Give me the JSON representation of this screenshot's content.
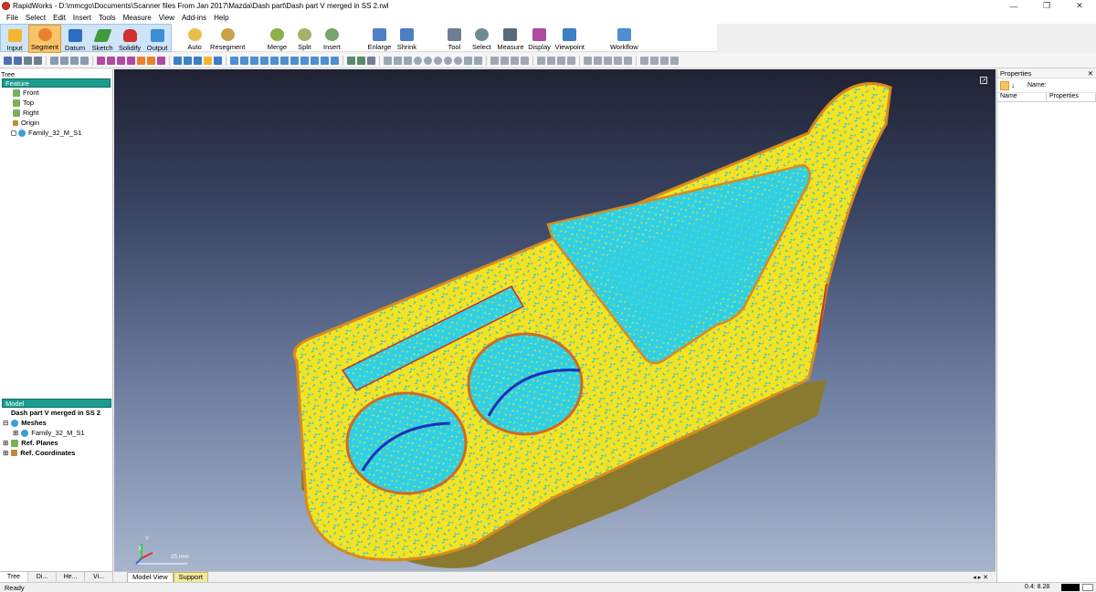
{
  "window": {
    "title": "RapidWorks - D:\\mmcgo\\Documents\\Scanner files From Jan 2017\\Mazda\\Dash part\\Dash part V merged in SS 2.rwl",
    "min": "—",
    "max": "❐",
    "close": "✕"
  },
  "menu": [
    "File",
    "Select",
    "Edit",
    "Insert",
    "Tools",
    "Measure",
    "View",
    "Add-ins",
    "Help"
  ],
  "ribbon": {
    "mode_buttons": [
      {
        "label": "Input",
        "icon": "input-icon",
        "color": "#f2b632"
      },
      {
        "label": "Segment",
        "icon": "segment-icon",
        "color": "#e9822d",
        "active": true
      },
      {
        "label": "Datum",
        "icon": "datum-icon",
        "color": "#2b6cc4"
      },
      {
        "label": "Sketch",
        "icon": "sketch-icon",
        "color": "#3f9a3a"
      },
      {
        "label": "Solidify",
        "icon": "solidify-icon",
        "color": "#d0312d"
      },
      {
        "label": "Output",
        "icon": "output-icon",
        "color": "#3a8fd6"
      }
    ],
    "tool_buttons": [
      {
        "label": "Auto",
        "icon": "auto-icon"
      },
      {
        "label": "Resegment",
        "icon": "resegment-icon"
      },
      {
        "label": "Merge",
        "icon": "merge-icon"
      },
      {
        "label": "Split",
        "icon": "split-icon"
      },
      {
        "label": "Insert",
        "icon": "insert-icon"
      },
      {
        "label": "Enlarge",
        "icon": "enlarge-icon"
      },
      {
        "label": "Shrink",
        "icon": "shrink-icon"
      },
      {
        "label": "Tool",
        "icon": "tool-icon"
      },
      {
        "label": "Select",
        "icon": "select-icon"
      },
      {
        "label": "Measure",
        "icon": "measure-icon"
      },
      {
        "label": "Display",
        "icon": "display-icon"
      },
      {
        "label": "Viewpoint",
        "icon": "viewpoint-icon"
      },
      {
        "label": "Workflow",
        "icon": "workflow-icon"
      }
    ]
  },
  "left_panel": {
    "header": "Tree",
    "feature_section": "Feature",
    "feature_items": [
      "Front",
      "Top",
      "Right",
      "Origin",
      "Family_32_M_S1"
    ],
    "model_section": "Model",
    "model_root": "Dash part V merged in SS 2",
    "model_items": [
      {
        "label": "Meshes",
        "bold": true
      },
      {
        "label": "Family_32_M_S1",
        "bold": false
      },
      {
        "label": "Ref. Planes",
        "bold": true
      },
      {
        "label": "Ref. Coordinates",
        "bold": true
      }
    ],
    "tabs": [
      "Tree",
      "Di...",
      "He...",
      "Vi..."
    ]
  },
  "viewport": {
    "scale_label": "25 mm",
    "axis_y": "Y",
    "axis_x": "X"
  },
  "bottom_tabs": [
    "Model View",
    "Support"
  ],
  "right_panel": {
    "header": "Properties",
    "name_label": "Name:",
    "col_name": "Name",
    "col_properties": "Properties"
  },
  "status": {
    "text": "Ready",
    "coord": "0.4: 8.28"
  }
}
